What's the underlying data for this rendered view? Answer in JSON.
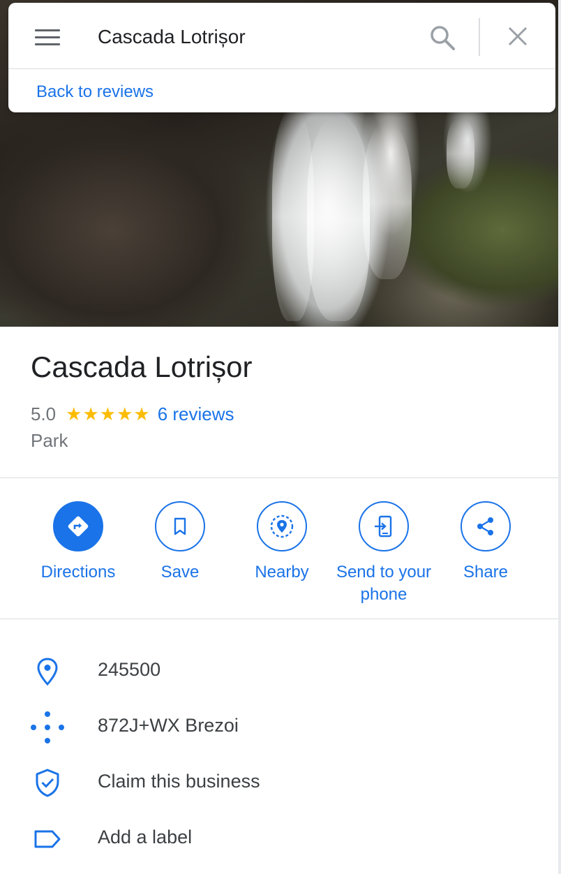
{
  "search": {
    "value": "Cascada Lotrișor",
    "back_link": "Back to reviews"
  },
  "place": {
    "name": "Cascada Lotrișor",
    "rating": "5.0",
    "stars": "★★★★★",
    "reviews_link": "6 reviews",
    "category": "Park"
  },
  "actions": [
    {
      "label": "Directions",
      "icon": "directions-icon"
    },
    {
      "label": "Save",
      "icon": "bookmark-icon"
    },
    {
      "label": "Nearby",
      "icon": "nearby-icon"
    },
    {
      "label": "Send to your phone",
      "icon": "send-to-phone-icon"
    },
    {
      "label": "Share",
      "icon": "share-icon"
    }
  ],
  "info": [
    {
      "text": "245500",
      "icon": "location-pin-icon"
    },
    {
      "text": "872J+WX Brezoi",
      "icon": "plus-code-icon"
    },
    {
      "text": "Claim this business",
      "icon": "shield-check-icon"
    },
    {
      "text": "Add a label",
      "icon": "label-icon"
    }
  ],
  "colors": {
    "accent": "#1a73e8",
    "star": "#fbbc04",
    "secondary_text": "#70757a"
  }
}
